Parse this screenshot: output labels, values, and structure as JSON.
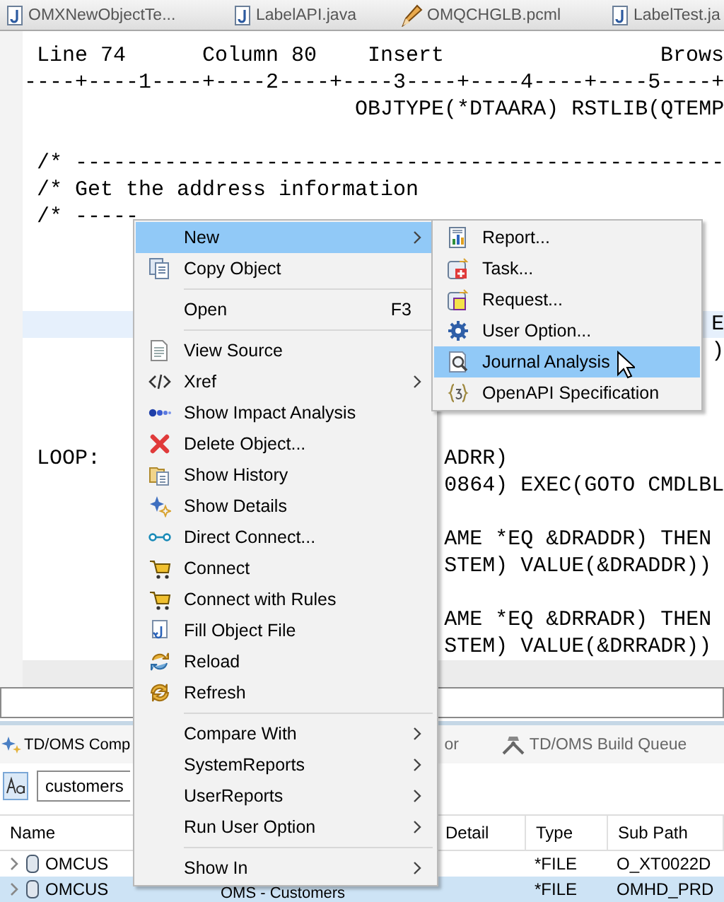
{
  "editor_tabs": [
    {
      "label": "OMXNewObjectTe...",
      "kind": "file"
    },
    {
      "label": "LabelAPI.java",
      "kind": "file"
    },
    {
      "label": "OMQCHGLB.pcml",
      "kind": "edit"
    },
    {
      "label": "LabelTest.ja",
      "kind": "file"
    }
  ],
  "editor": {
    "position_bar": {
      "line": "Line 74",
      "column": "Column 80",
      "mode": "Insert",
      "view": "Brows"
    },
    "ruler": "----+----1----+----2----+----3----+----4----+----5----+",
    "lines": [
      {
        "kind": "text",
        "segments": [
          "                          OBJTYPE(*DTAARA) RSTLIB(QTEMP"
        ],
        "current": false
      },
      {
        "kind": "blank"
      },
      {
        "kind": "text",
        "segments": [
          " /* ---------------------------------------------------"
        ],
        "current": false
      },
      {
        "kind": "text",
        "segments": [
          " /* Get the address information"
        ],
        "current": false
      },
      {
        "kind": "text",
        "segments": [
          " /* -----"
        ],
        "current": false
      },
      {
        "kind": "blank"
      },
      {
        "kind": "blank"
      },
      {
        "kind": "blank"
      },
      {
        "kind": "text",
        "segments": [
          "                                                      E"
        ],
        "current": true
      },
      {
        "kind": "text",
        "segments": [
          "                                                      )"
        ],
        "current": false
      },
      {
        "kind": "blank"
      },
      {
        "kind": "blank"
      },
      {
        "kind": "blank"
      },
      {
        "kind": "text",
        "segments": [
          " LOOP:",
          "                           ADRR)"
        ],
        "current": false
      },
      {
        "kind": "text",
        "segments": [
          "                                 0864) EXEC(GOTO CMDLBL"
        ],
        "current": false
      },
      {
        "kind": "blank"
      },
      {
        "kind": "text",
        "segments": [
          "                                 AME *EQ &DRADDR) THEN"
        ],
        "current": false
      },
      {
        "kind": "text",
        "segments": [
          "                                 STEM) VALUE(&DRADDR))"
        ],
        "current": false
      },
      {
        "kind": "blank"
      },
      {
        "kind": "text",
        "segments": [
          "                                 AME *EQ &DRRADR) THEN"
        ],
        "current": false
      },
      {
        "kind": "text",
        "segments": [
          "                                 STEM) VALUE(&DRRADR))"
        ],
        "current": false
      }
    ]
  },
  "bottom_panel": {
    "tabs": [
      {
        "label": "TD/OMS Comp",
        "selected": true
      },
      {
        "label": "or",
        "selected": false
      },
      {
        "label": "TD/OMS Build Queue",
        "selected": false
      }
    ],
    "search": {
      "value": "customers"
    },
    "table": {
      "columns": [
        "Name",
        "Detail",
        "Type",
        "Sub Path"
      ],
      "rows": [
        {
          "name": "OMCUS",
          "type": "*FILE",
          "sub_path": "O_XT0022D",
          "expanded": false,
          "selected": false
        },
        {
          "name": "OMCUS",
          "column_2": "OMS - Customers",
          "type": "*FILE",
          "sub_path": "OMHD_PRD",
          "expanded": false,
          "selected": true
        }
      ]
    }
  },
  "context_menu": {
    "items": [
      {
        "kind": "item",
        "label": "New",
        "submenu": true,
        "selected": true
      },
      {
        "kind": "item",
        "label": "Copy Object",
        "submenu": false,
        "selected": false
      },
      {
        "kind": "separator"
      },
      {
        "kind": "item",
        "label": "Open",
        "shortcut": "F3",
        "submenu": false,
        "selected": false
      },
      {
        "kind": "separator"
      },
      {
        "kind": "item",
        "label": "View Source",
        "submenu": false,
        "selected": false
      },
      {
        "kind": "item",
        "label": "Xref",
        "submenu": true,
        "selected": false
      },
      {
        "kind": "item",
        "label": "Show Impact Analysis",
        "submenu": false,
        "selected": false
      },
      {
        "kind": "item",
        "label": "Delete Object...",
        "submenu": false,
        "selected": false
      },
      {
        "kind": "item",
        "label": "Show History",
        "submenu": false,
        "selected": false
      },
      {
        "kind": "item",
        "label": "Show Details",
        "submenu": false,
        "selected": false
      },
      {
        "kind": "item",
        "label": "Direct Connect...",
        "submenu": false,
        "selected": false
      },
      {
        "kind": "item",
        "label": "Connect",
        "submenu": false,
        "selected": false
      },
      {
        "kind": "item",
        "label": "Connect with Rules",
        "submenu": false,
        "selected": false
      },
      {
        "kind": "item",
        "label": "Fill Object File",
        "submenu": false,
        "selected": false
      },
      {
        "kind": "item",
        "label": "Reload",
        "submenu": false,
        "selected": false
      },
      {
        "kind": "item",
        "label": "Refresh",
        "submenu": false,
        "selected": false
      },
      {
        "kind": "separator"
      },
      {
        "kind": "item",
        "label": "Compare With",
        "submenu": true,
        "selected": false
      },
      {
        "kind": "item",
        "label": "SystemReports",
        "submenu": true,
        "selected": false
      },
      {
        "kind": "item",
        "label": "UserReports",
        "submenu": true,
        "selected": false
      },
      {
        "kind": "item",
        "label": "Run User Option",
        "submenu": true,
        "selected": false
      },
      {
        "kind": "separator"
      },
      {
        "kind": "item",
        "label": "Show In",
        "submenu": true,
        "selected": false
      }
    ]
  },
  "new_submenu": {
    "items": [
      {
        "kind": "item",
        "label": "Report...",
        "submenu": false,
        "selected": false
      },
      {
        "kind": "item",
        "label": "Task...",
        "submenu": false,
        "selected": false
      },
      {
        "kind": "item",
        "label": "Request...",
        "submenu": false,
        "selected": false
      },
      {
        "kind": "item",
        "label": "User Option...",
        "submenu": false,
        "selected": false
      },
      {
        "kind": "item",
        "label": "Journal Analysis",
        "submenu": false,
        "selected": true
      },
      {
        "kind": "item",
        "label": "OpenAPI Specification",
        "submenu": false,
        "selected": false
      }
    ]
  }
}
